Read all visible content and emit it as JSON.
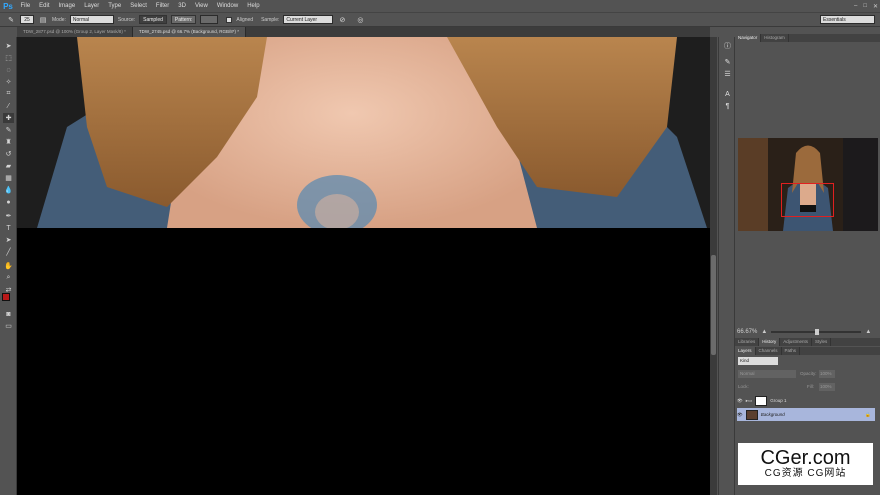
{
  "app": {
    "logo": "Ps"
  },
  "menu": [
    "File",
    "Edit",
    "Image",
    "Layer",
    "Type",
    "Select",
    "Filter",
    "3D",
    "View",
    "Window",
    "Help"
  ],
  "window_controls": [
    "–",
    "□",
    "✕"
  ],
  "options": {
    "brush_size": "25",
    "mode_label": "Mode:",
    "mode_value": "Normal",
    "source_label": "Source:",
    "source_sampled": "Sampled",
    "source_pattern": "Pattern:",
    "aligned_label": "Aligned",
    "sample_label": "Sample:",
    "sample_value": "Current Layer",
    "workspace": "Essentials"
  },
  "doc_tabs": [
    {
      "label": "TDW_2877.psd @ 100% (Group 2, Layer Mask/8) *",
      "active": false
    },
    {
      "label": "TDW_2745.psd @ 66.7% (Background, RGB/8*) *",
      "active": true
    }
  ],
  "navigator": {
    "tabs": [
      "Navigator",
      "Histogram"
    ],
    "zoom": "66.67%"
  },
  "history_tabs": [
    "Libraries",
    "History",
    "Adjustments",
    "Styles"
  ],
  "layers": {
    "tabs": [
      "Layers",
      "Channels",
      "Paths"
    ],
    "kind": "Kind",
    "blend": "Normal",
    "opacity_label": "Opacity:",
    "opacity": "100%",
    "lock_label": "Lock:",
    "fill_label": "Fill:",
    "fill": "100%",
    "items": [
      {
        "name": "Group 1",
        "selected": false
      },
      {
        "name": "Background",
        "selected": true
      }
    ]
  },
  "watermark": {
    "main": "CGer.com",
    "sub": "CG资源 CG网站"
  },
  "colors": {
    "foreground": "#b81818",
    "accent": "#31a8ff",
    "selected_layer": "#a8b6dc"
  }
}
